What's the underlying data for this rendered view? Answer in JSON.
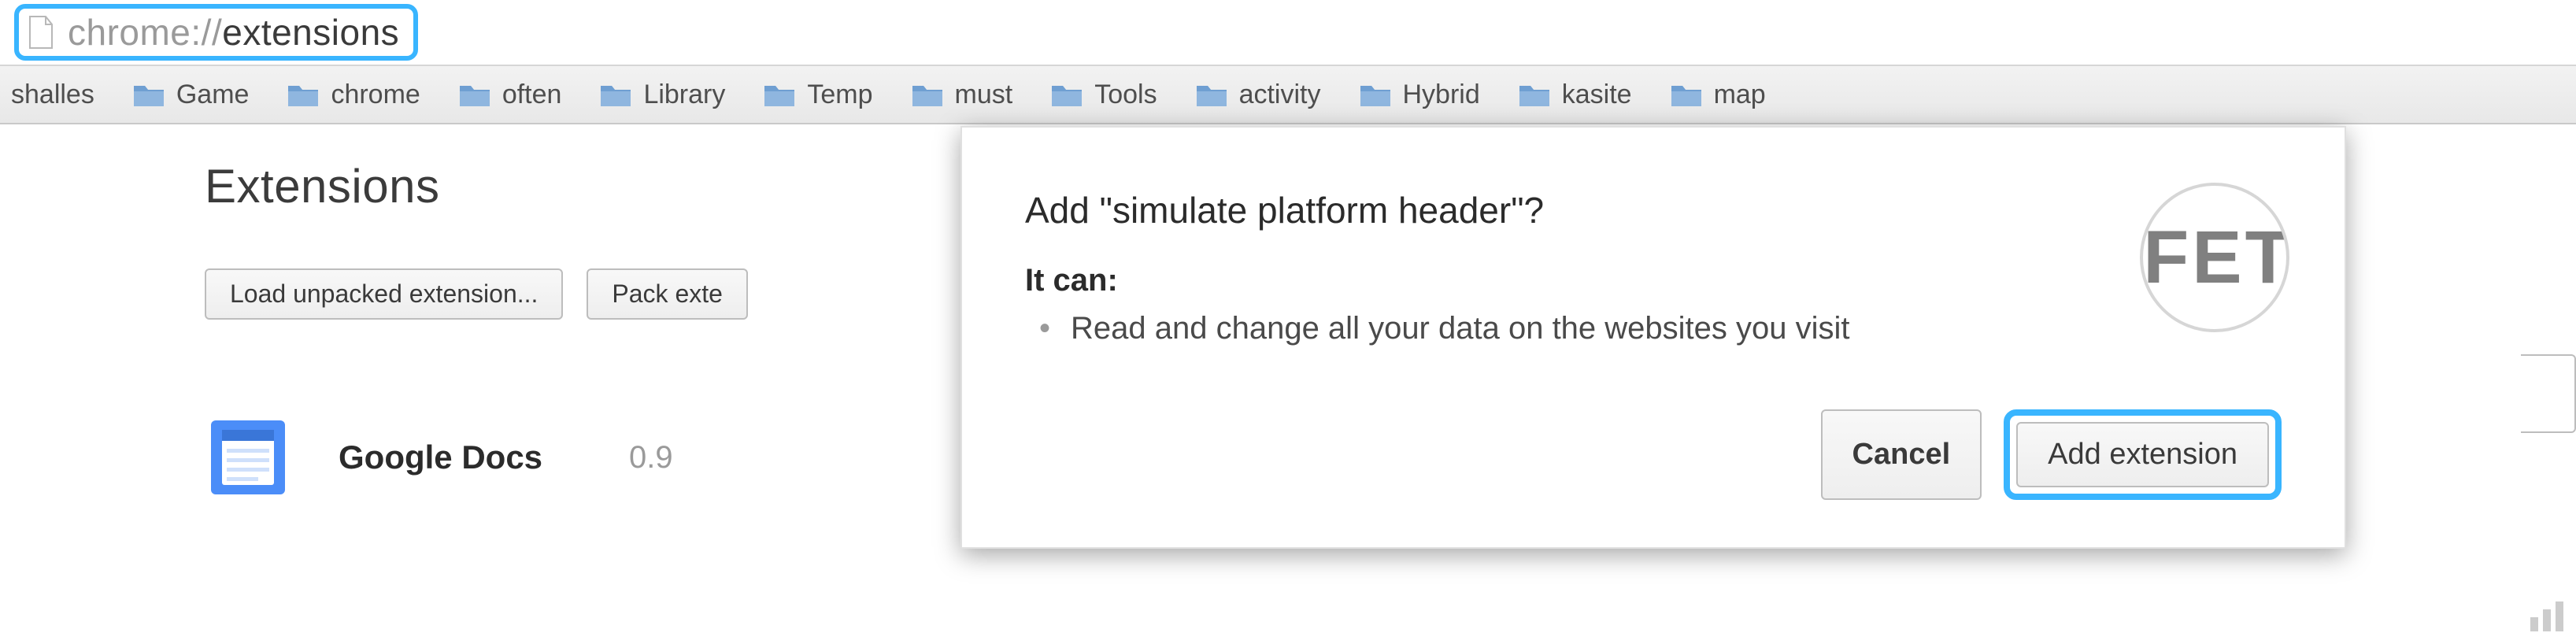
{
  "url": {
    "protocol": "chrome://",
    "path": "extensions"
  },
  "bookmarks": [
    {
      "label": "shalles"
    },
    {
      "label": "Game"
    },
    {
      "label": "chrome"
    },
    {
      "label": "often"
    },
    {
      "label": "Library"
    },
    {
      "label": "Temp"
    },
    {
      "label": "must"
    },
    {
      "label": "Tools"
    },
    {
      "label": "activity"
    },
    {
      "label": "Hybrid"
    },
    {
      "label": "kasite"
    },
    {
      "label": "map"
    }
  ],
  "page": {
    "title": "Extensions"
  },
  "toolbar": {
    "load_unpacked": "Load unpacked extension...",
    "pack_extension_partial": "Pack exte"
  },
  "extensions_list": [
    {
      "name": "Google Docs",
      "version": "0.9"
    }
  ],
  "dialog": {
    "title": "Add \"simulate platform header\"?",
    "subtitle": "It can:",
    "bullets": [
      "Read and change all your data on the websites you visit"
    ],
    "icon_text": "FET",
    "cancel": "Cancel",
    "confirm": "Add extension"
  }
}
